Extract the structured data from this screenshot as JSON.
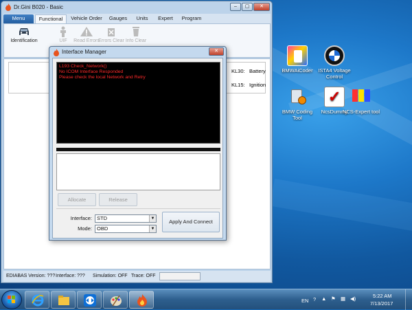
{
  "main_window": {
    "title": "Dr.Gini B020 - Basic",
    "menu_tabs": [
      "Menu",
      "Functional",
      "Vehicle Order",
      "Gauges",
      "Units",
      "Expert",
      "Program"
    ],
    "ribbon": [
      {
        "label": "Identification",
        "icon": "car-icon",
        "enabled": true
      },
      {
        "label": "UIF",
        "icon": "person-icon",
        "enabled": false
      },
      {
        "label": "Read Errors",
        "icon": "warning-icon",
        "enabled": false
      },
      {
        "label": "Errors Clear",
        "icon": "delete-icon",
        "enabled": false
      },
      {
        "label": "Info Clear",
        "icon": "trash-icon",
        "enabled": false
      }
    ],
    "kl30": {
      "label": "KL30:",
      "value": "Battery"
    },
    "kl15": {
      "label": "KL15:",
      "value": "Ignition"
    },
    "status": {
      "ediabas": "EDIABAS Version:  ???",
      "interface": "Interface:  ???",
      "simulation": "Simulation:  OFF",
      "trace": "Trace:  OFF"
    }
  },
  "dialog": {
    "title": "Interface Manager",
    "console_lines": [
      "L193 Check_Network()",
      "No ICOM Interface Responded",
      "Please check the local Network and Retry"
    ],
    "allocate_label": "Allocate",
    "release_label": "Release",
    "interface_label": "Interface:",
    "interface_value": "STD",
    "mode_label": "Mode:",
    "mode_value": "OBD",
    "apply_label": "Apply And Connect"
  },
  "desktop_icons": [
    {
      "label": "BMWAiCoder",
      "icon": "bmwaicoder-icon"
    },
    {
      "label": "ISTA4 Voltage Control",
      "icon": "bmw-logo-icon"
    },
    {
      "label": "BMW Coding Tool",
      "icon": "bmw-coding-tool-icon"
    },
    {
      "label": "NcsDummy",
      "icon": "ncsdummy-icon"
    },
    {
      "label": "NCS-Expert tool",
      "icon": "ncs-expert-icon"
    }
  ],
  "taskbar": {
    "apps": [
      "ie-icon",
      "explorer-icon",
      "teamviewer-icon",
      "paint-icon",
      "drgini-icon"
    ],
    "language": "EN",
    "time": "5:22 AM",
    "date": "7/13/2017"
  }
}
